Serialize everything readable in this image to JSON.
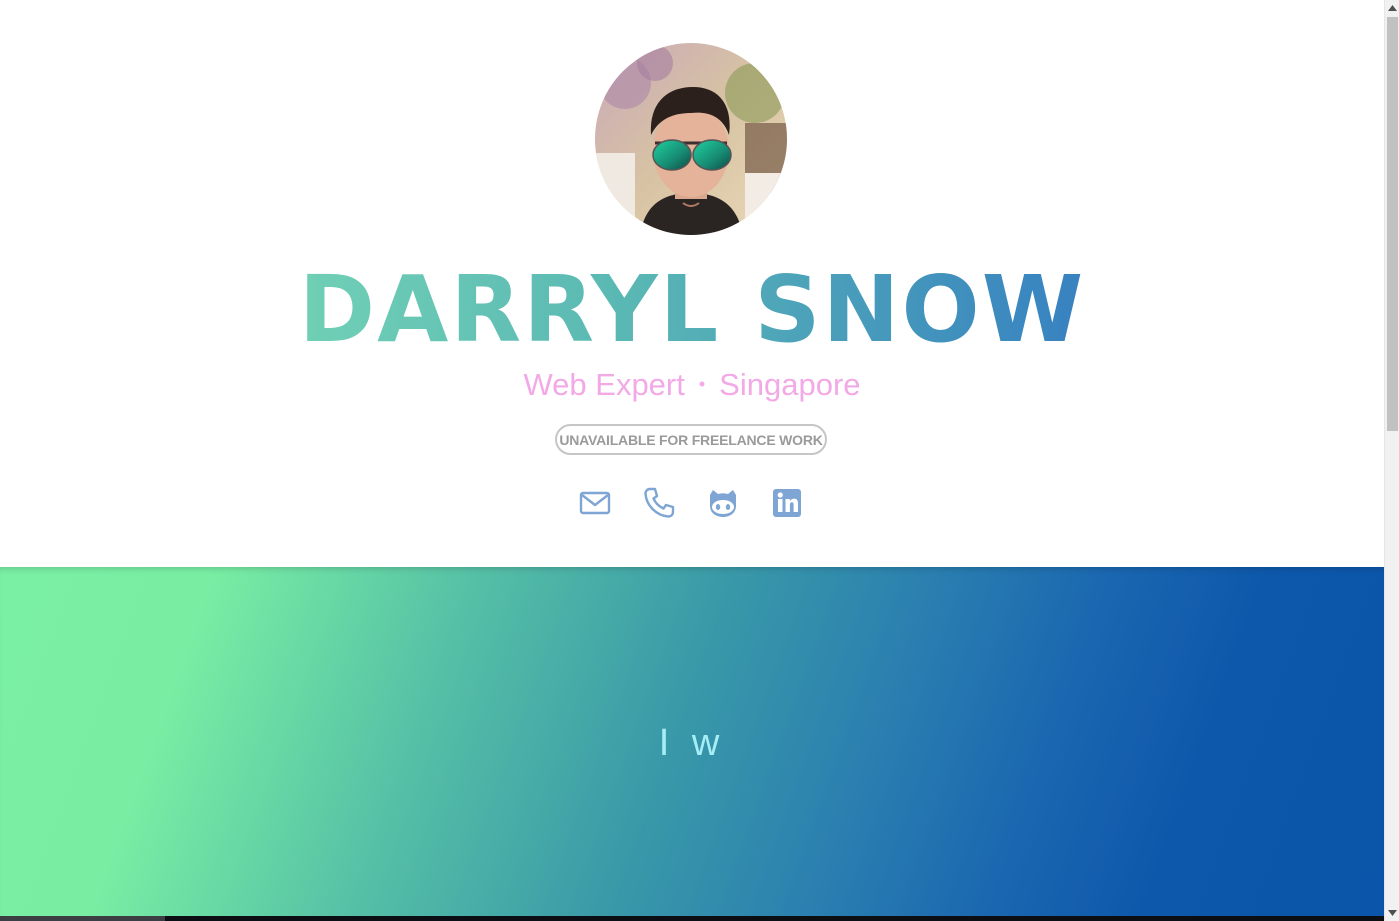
{
  "profile": {
    "name": "DARRYL SNOW",
    "role": "Web Expert",
    "separator": "•",
    "location": "Singapore",
    "availability": "UNAVAILABLE FOR FREELANCE WORK"
  },
  "social": {
    "items": [
      {
        "icon": "mail-icon"
      },
      {
        "icon": "phone-icon"
      },
      {
        "icon": "github-icon"
      },
      {
        "icon": "linkedin-icon"
      }
    ],
    "icon_color": "#7ea5d3"
  },
  "hero": {
    "typing_text": "I w"
  },
  "colors": {
    "name_gradient_start": "#84e6b6",
    "name_gradient_end": "#2f6fc0",
    "subtitle": "#f2a9e6",
    "band_gradient_start": "#7af0a4",
    "band_gradient_end": "#0b55aa"
  }
}
